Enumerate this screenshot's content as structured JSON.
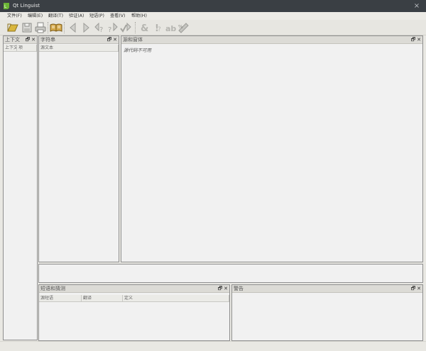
{
  "window": {
    "title": "Qt Linguist",
    "close_glyph": "×"
  },
  "menu": [
    {
      "label": "文件(F)"
    },
    {
      "label": "编辑(E)"
    },
    {
      "label": "翻译(T)"
    },
    {
      "label": "验证(A)"
    },
    {
      "label": "短语(P)"
    },
    {
      "label": "查看(V)"
    },
    {
      "label": "帮助(H)"
    }
  ],
  "toolbar": {
    "groups": [
      [
        "open-icon",
        "save-icon",
        "print-icon"
      ],
      [
        "open-phrasebook-icon"
      ],
      [
        "previous-icon",
        "next-icon",
        "previous-unfinished-icon",
        "next-unfinished-icon",
        "done-and-next-icon"
      ],
      [
        "accelerator-validation-icon",
        "punctuation-validation-icon",
        "phrase-validation-icon",
        "placemarker-validation-icon"
      ]
    ]
  },
  "docks": {
    "context": {
      "title": "上下文",
      "columns": [
        "上下文",
        "项"
      ]
    },
    "strings": {
      "title": "字符串",
      "columns": [
        "源文本"
      ]
    },
    "source": {
      "title": "源和窗体",
      "message": "源代码不可用"
    },
    "phrases": {
      "title": "短语和猜测",
      "columns": [
        "源短语",
        "翻译",
        "定义"
      ]
    },
    "warnings": {
      "title": "警告"
    }
  },
  "dock_buttons": {
    "float": "🗗",
    "close": "✕"
  },
  "colors": {
    "titlebar": "#3a3f44",
    "pane_bg": "#f1f1f1",
    "pane_border": "#8e8e8e",
    "icon_gold": "#c9a227"
  }
}
